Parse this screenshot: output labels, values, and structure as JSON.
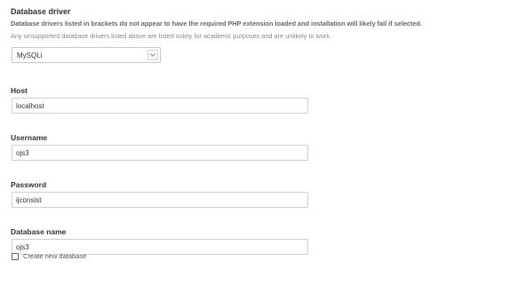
{
  "section": {
    "title": "Database driver",
    "help_bold": "Database drivers listed in brackets do not appear to have the required PHP extension loaded and installation will likely fail if selected.",
    "help_light": "Any unsupported database drivers listed above are listed solely for academic purposes and are unlikely to work."
  },
  "driver_select": {
    "value": "MySQLi",
    "icon": "chevron-down-icon"
  },
  "fields": {
    "host": {
      "label": "Host",
      "value": "localhost"
    },
    "username": {
      "label": "Username",
      "value": "ojs3"
    },
    "password": {
      "label": "Password",
      "value": "ijconsist"
    },
    "database_name": {
      "label": "Database name",
      "value": "ojs3"
    }
  },
  "create_db": {
    "label": "Create new database",
    "checked": false
  },
  "colors": {
    "border": "#cfcfcf",
    "label": "#333333",
    "help": "#666666"
  }
}
